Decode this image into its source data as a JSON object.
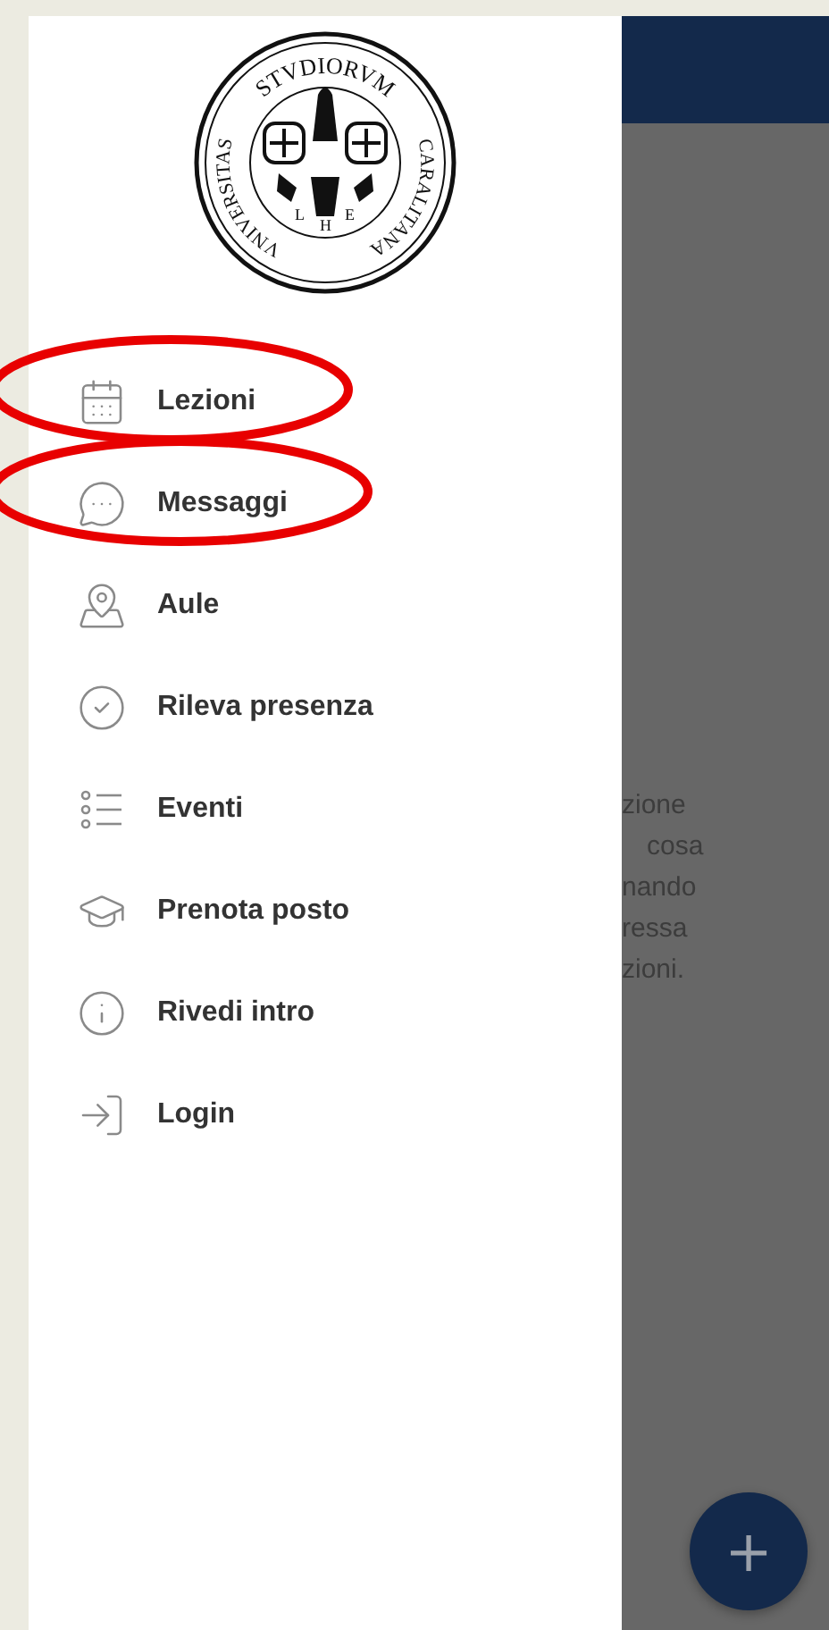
{
  "seal": {
    "top": "STVDIORVM",
    "left": "VNIVERSITAS",
    "right": "CARALITANA",
    "letters": [
      "L",
      "H",
      "E"
    ]
  },
  "menu": [
    {
      "label": "Lezioni",
      "circled": true
    },
    {
      "label": "Messaggi",
      "circled": true
    },
    {
      "label": "Aule",
      "circled": false
    },
    {
      "label": "Rileva presenza",
      "circled": false
    },
    {
      "label": "Eventi",
      "circled": false
    },
    {
      "label": "Prenota posto",
      "circled": false
    },
    {
      "label": "Rivedi intro",
      "circled": false
    },
    {
      "label": "Login",
      "circled": false
    }
  ],
  "background": {
    "lines": [
      "zione",
      "cosa",
      "nando",
      "ressa",
      "zioni."
    ]
  },
  "fab": {
    "label": "+"
  }
}
